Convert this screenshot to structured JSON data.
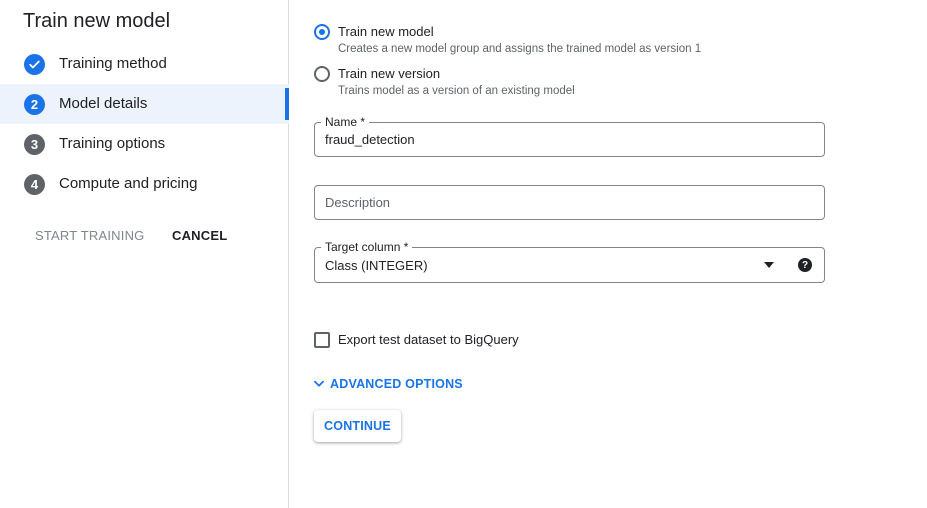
{
  "page_title": "Train new model",
  "steps": [
    {
      "number": "1",
      "label": "Training method",
      "state": "done"
    },
    {
      "number": "2",
      "label": "Model details",
      "state": "current"
    },
    {
      "number": "3",
      "label": "Training options",
      "state": "todo"
    },
    {
      "number": "4",
      "label": "Compute and pricing",
      "state": "todo"
    }
  ],
  "sidebar_actions": {
    "start_training": "START TRAINING",
    "cancel": "CANCEL"
  },
  "training_type": {
    "new_model": {
      "label": "Train new model",
      "description": "Creates a new model group and assigns the trained model as version 1",
      "selected": true
    },
    "new_version": {
      "label": "Train new version",
      "description": "Trains model as a version of an existing model",
      "selected": false
    }
  },
  "name_field": {
    "label": "Name *",
    "value": "fraud_detection"
  },
  "description_field": {
    "placeholder": "Description",
    "value": ""
  },
  "target_column": {
    "label": "Target column *",
    "value": "Class (INTEGER)"
  },
  "export_checkbox": {
    "label": "Export test dataset to BigQuery",
    "checked": false
  },
  "advanced_options": {
    "label": "ADVANCED OPTIONS"
  },
  "continue_button": {
    "label": "CONTINUE"
  },
  "colors": {
    "accent": "#1a73e8",
    "active_bg": "#edf3fd",
    "text": "#202124",
    "muted": "#5f6368"
  }
}
